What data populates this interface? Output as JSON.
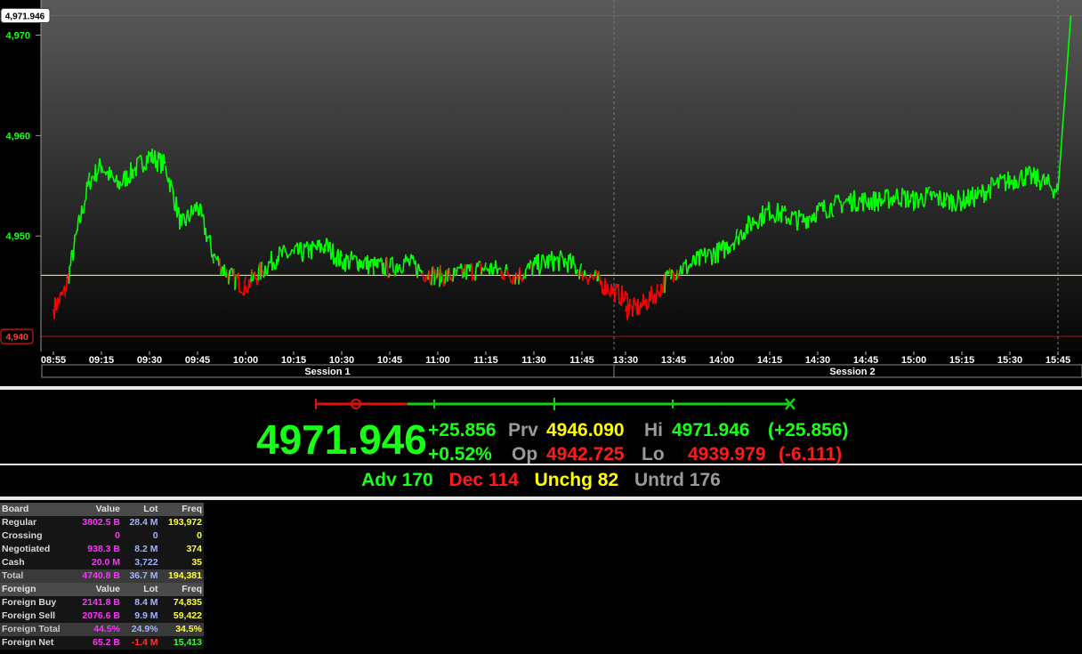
{
  "chart": {
    "y_axis": {
      "ticks": [
        "4,970",
        "4,960",
        "4,950"
      ],
      "current_label": "4,971.946",
      "low_label": "4,940"
    },
    "x_axis": {
      "session1_times": [
        "08:55",
        "09:15",
        "09:30",
        "09:45",
        "10:00",
        "10:15",
        "10:30",
        "10:45",
        "11:00",
        "11:15",
        "11:30",
        "11:45"
      ],
      "session2_times": [
        "13:30",
        "13:45",
        "14:00",
        "14:15",
        "14:30",
        "14:45",
        "15:00",
        "15:15",
        "15:30",
        "15:45"
      ],
      "sessions": [
        "Session 1",
        "Session 2"
      ]
    },
    "reference_value": 4946.09,
    "colors": {
      "up": "#00ff00",
      "down": "#ff0000",
      "reference_line": "#ffff66",
      "high_line": "#2e8b2e",
      "low_line": "#8b1a1a"
    }
  },
  "chart_data": {
    "type": "line",
    "title": "",
    "ylim": [
      4938.5,
      4973.5
    ],
    "reference_line": 4946.09,
    "sessions": [
      {
        "name": "Session 1",
        "x": [
          "08:55",
          "09:00",
          "09:05",
          "09:10",
          "09:15",
          "09:20",
          "09:25",
          "09:30",
          "09:35",
          "09:40",
          "09:45",
          "09:50",
          "09:55",
          "10:00",
          "10:05",
          "10:10",
          "10:15",
          "10:20",
          "10:25",
          "10:30",
          "10:35",
          "10:40",
          "10:45",
          "10:50",
          "10:55",
          "11:00",
          "11:05",
          "11:10",
          "11:15",
          "11:20",
          "11:25",
          "11:30",
          "11:35",
          "11:40",
          "11:45",
          "11:50",
          "11:55",
          "12:00"
        ],
        "y": [
          4942.7,
          4944.5,
          4950.5,
          4955.5,
          4957.0,
          4955.0,
          4956.5,
          4958.0,
          4957.0,
          4951.0,
          4953.0,
          4948.0,
          4946.0,
          4945.0,
          4946.5,
          4948.0,
          4948.2,
          4948.5,
          4949.0,
          4947.5,
          4947.5,
          4947.0,
          4946.8,
          4947.5,
          4946.5,
          4946.0,
          4946.0,
          4946.5,
          4946.8,
          4946.5,
          4946.0,
          4947.0,
          4947.5,
          4947.5,
          4946.5,
          4945.5,
          4944.5,
          4943.5
        ]
      },
      {
        "name": "Session 2",
        "x": [
          "13:30",
          "13:35",
          "13:40",
          "13:45",
          "13:50",
          "13:55",
          "14:00",
          "14:05",
          "14:10",
          "14:15",
          "14:20",
          "14:25",
          "14:30",
          "14:35",
          "14:40",
          "14:45",
          "14:50",
          "14:55",
          "15:00",
          "15:05",
          "15:10",
          "15:15",
          "15:20",
          "15:25",
          "15:30",
          "15:35",
          "15:40",
          "15:45",
          "15:49"
        ],
        "y": [
          4942.5,
          4943.0,
          4944.5,
          4946.5,
          4947.0,
          4948.0,
          4948.5,
          4950.0,
          4951.5,
          4952.5,
          4952.0,
          4951.5,
          4952.5,
          4953.0,
          4953.5,
          4953.5,
          4953.5,
          4954.0,
          4953.5,
          4954.0,
          4953.5,
          4953.5,
          4954.0,
          4955.0,
          4955.5,
          4956.0,
          4955.5,
          4954.5,
          4971.946
        ]
      }
    ],
    "high": 4971.946,
    "low": 4939.979
  },
  "quote": {
    "last": "4971.946",
    "change": "+25.856",
    "change_pct": "+0.52%",
    "prev_label": "Prv",
    "prev_value": "4946.090",
    "open_label": "Op",
    "open_value": "4942.725",
    "high_label": "Hi",
    "high_value": "4971.946",
    "high_change": "(+25.856)",
    "low_label": "Lo",
    "low_value": "4939.979",
    "low_change": "(-6.111)"
  },
  "breadth": {
    "adv": "Adv 170",
    "dec": "Dec 114",
    "unchg": "Unchg 82",
    "untrd": "Untrd 176"
  },
  "board": {
    "header": [
      "Board",
      "Value",
      "Lot",
      "Freq"
    ],
    "rows": [
      [
        "Regular",
        "3802.5 B",
        "28.4 M",
        "193,972"
      ],
      [
        "Crossing",
        "0",
        "0",
        "0"
      ],
      [
        "Negotiated",
        "938.3 B",
        "8.2 M",
        "374"
      ],
      [
        "Cash",
        "20.0 M",
        "3,722",
        "35"
      ],
      [
        "Total",
        "4740.8 B",
        "36.7 M",
        "194,381"
      ]
    ],
    "foreign_header": [
      "Foreign",
      "Value",
      "Lot",
      "Freq"
    ],
    "foreign_rows": [
      [
        "Foreign Buy",
        "2141.8 B",
        "8.4 M",
        "74,835"
      ],
      [
        "Foreign Sell",
        "2076.6 B",
        "9.9 M",
        "59,422"
      ],
      [
        "Foreign Total",
        "44.5%",
        "24.9%",
        "34.5%"
      ],
      [
        "Foreign Net",
        "65.2 B",
        "-1.4 M",
        "15,413"
      ]
    ]
  }
}
